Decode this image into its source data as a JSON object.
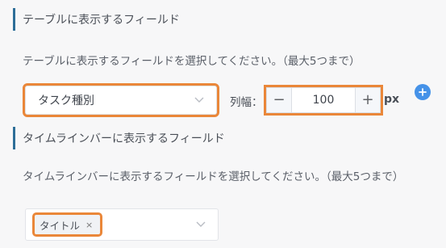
{
  "table_section": {
    "title": "テーブルに表示するフィールド",
    "description": "テーブルに表示するフィールドを選択してください。（最大5つまで）",
    "select_value": "タスク種別",
    "column_width_label": "列幅：",
    "stepper": {
      "minus": "−",
      "value": "100",
      "plus": "+"
    },
    "unit": "px",
    "add_icon": "plus-circle-icon"
  },
  "timeline_section": {
    "title": "タイムラインバーに表示するフィールド",
    "description": "タイムラインバーに表示するフィールドを選択してください。（最大5つまで）",
    "tag_label": "タイトル",
    "tag_close": "×"
  },
  "colors": {
    "accent_bar": "#2d6e98",
    "highlight": "#ea8739",
    "add_button": "#4592e8"
  }
}
